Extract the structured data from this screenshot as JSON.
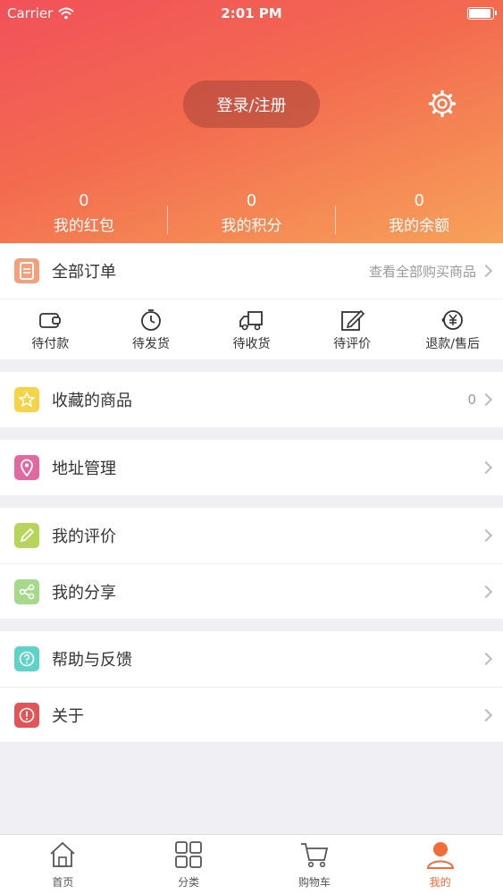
{
  "status_bar": {
    "carrier": "Carrier",
    "time": "2:01 PM"
  },
  "header": {
    "login_label": "登录/注册",
    "stats": [
      {
        "value": "0",
        "label": "我的红包"
      },
      {
        "value": "0",
        "label": "我的积分"
      },
      {
        "value": "0",
        "label": "我的余额"
      }
    ]
  },
  "orders": {
    "title": "全部订单",
    "view_all": "查看全部购买商品",
    "items": [
      {
        "label": "待付款",
        "icon": "wallet-icon"
      },
      {
        "label": "待发货",
        "icon": "clock-icon"
      },
      {
        "label": "待收货",
        "icon": "truck-icon"
      },
      {
        "label": "待评价",
        "icon": "edit-icon"
      },
      {
        "label": "退款/售后",
        "icon": "refund-icon"
      }
    ]
  },
  "favorites": {
    "title": "收藏的商品",
    "count": "0",
    "color": "#f5d44a"
  },
  "address": {
    "title": "地址管理",
    "color": "#e06aa0"
  },
  "reviews": {
    "title": "我的评价",
    "color": "#b6d55a"
  },
  "shares": {
    "title": "我的分享",
    "color": "#a6d98a"
  },
  "help": {
    "title": "帮助与反馈",
    "color": "#5fd3c8"
  },
  "about": {
    "title": "关于",
    "color": "#e05555"
  },
  "tabbar": {
    "items": [
      {
        "label": "首页",
        "icon": "home-icon"
      },
      {
        "label": "分类",
        "icon": "grid-icon"
      },
      {
        "label": "购物车",
        "icon": "cart-icon"
      },
      {
        "label": "我的",
        "icon": "user-icon",
        "active": true
      }
    ],
    "active_color": "#f36b3a"
  }
}
